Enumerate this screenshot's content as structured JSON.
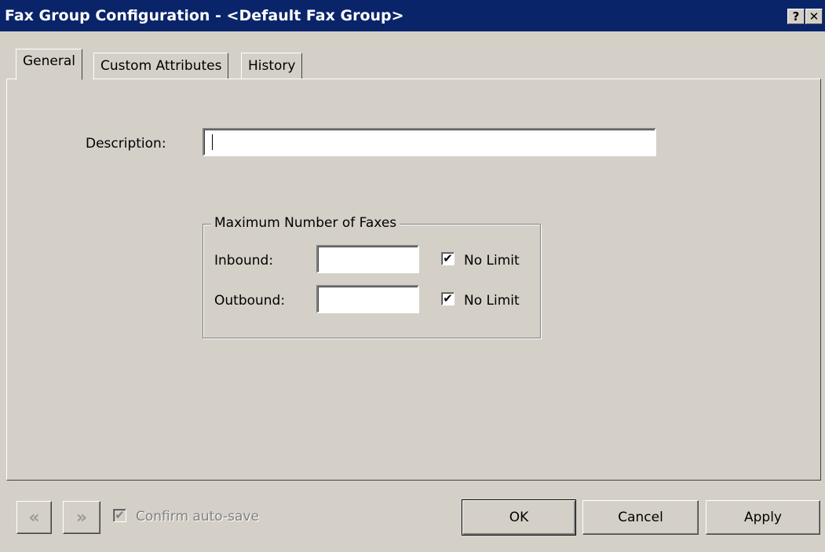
{
  "window": {
    "title": "Fax Group Configuration - <Default Fax Group>",
    "help_button": "?",
    "close_button": "✕"
  },
  "tabs": [
    {
      "label": "General",
      "active": true
    },
    {
      "label": "Custom Attributes",
      "active": false
    },
    {
      "label": "History",
      "active": false
    }
  ],
  "general": {
    "description_label": "Description:",
    "description_value": "",
    "group_title": "Maximum Number of Faxes",
    "inbound_label": "Inbound:",
    "inbound_value": "",
    "inbound_nolimit_label": "No Limit",
    "inbound_nolimit_checked": true,
    "outbound_label": "Outbound:",
    "outbound_value": "",
    "outbound_nolimit_label": "No Limit",
    "outbound_nolimit_checked": true
  },
  "footer": {
    "prev_icon": "double-chevron-left-icon",
    "next_icon": "double-chevron-right-icon",
    "prev_glyph": "«",
    "next_glyph": "»",
    "confirm_label": "Confirm auto-save",
    "confirm_checked": true,
    "ok_label": "OK",
    "cancel_label": "Cancel",
    "apply_label": "Apply"
  },
  "colors": {
    "titlebar": "#0a246a",
    "face": "#d4d0c8"
  }
}
